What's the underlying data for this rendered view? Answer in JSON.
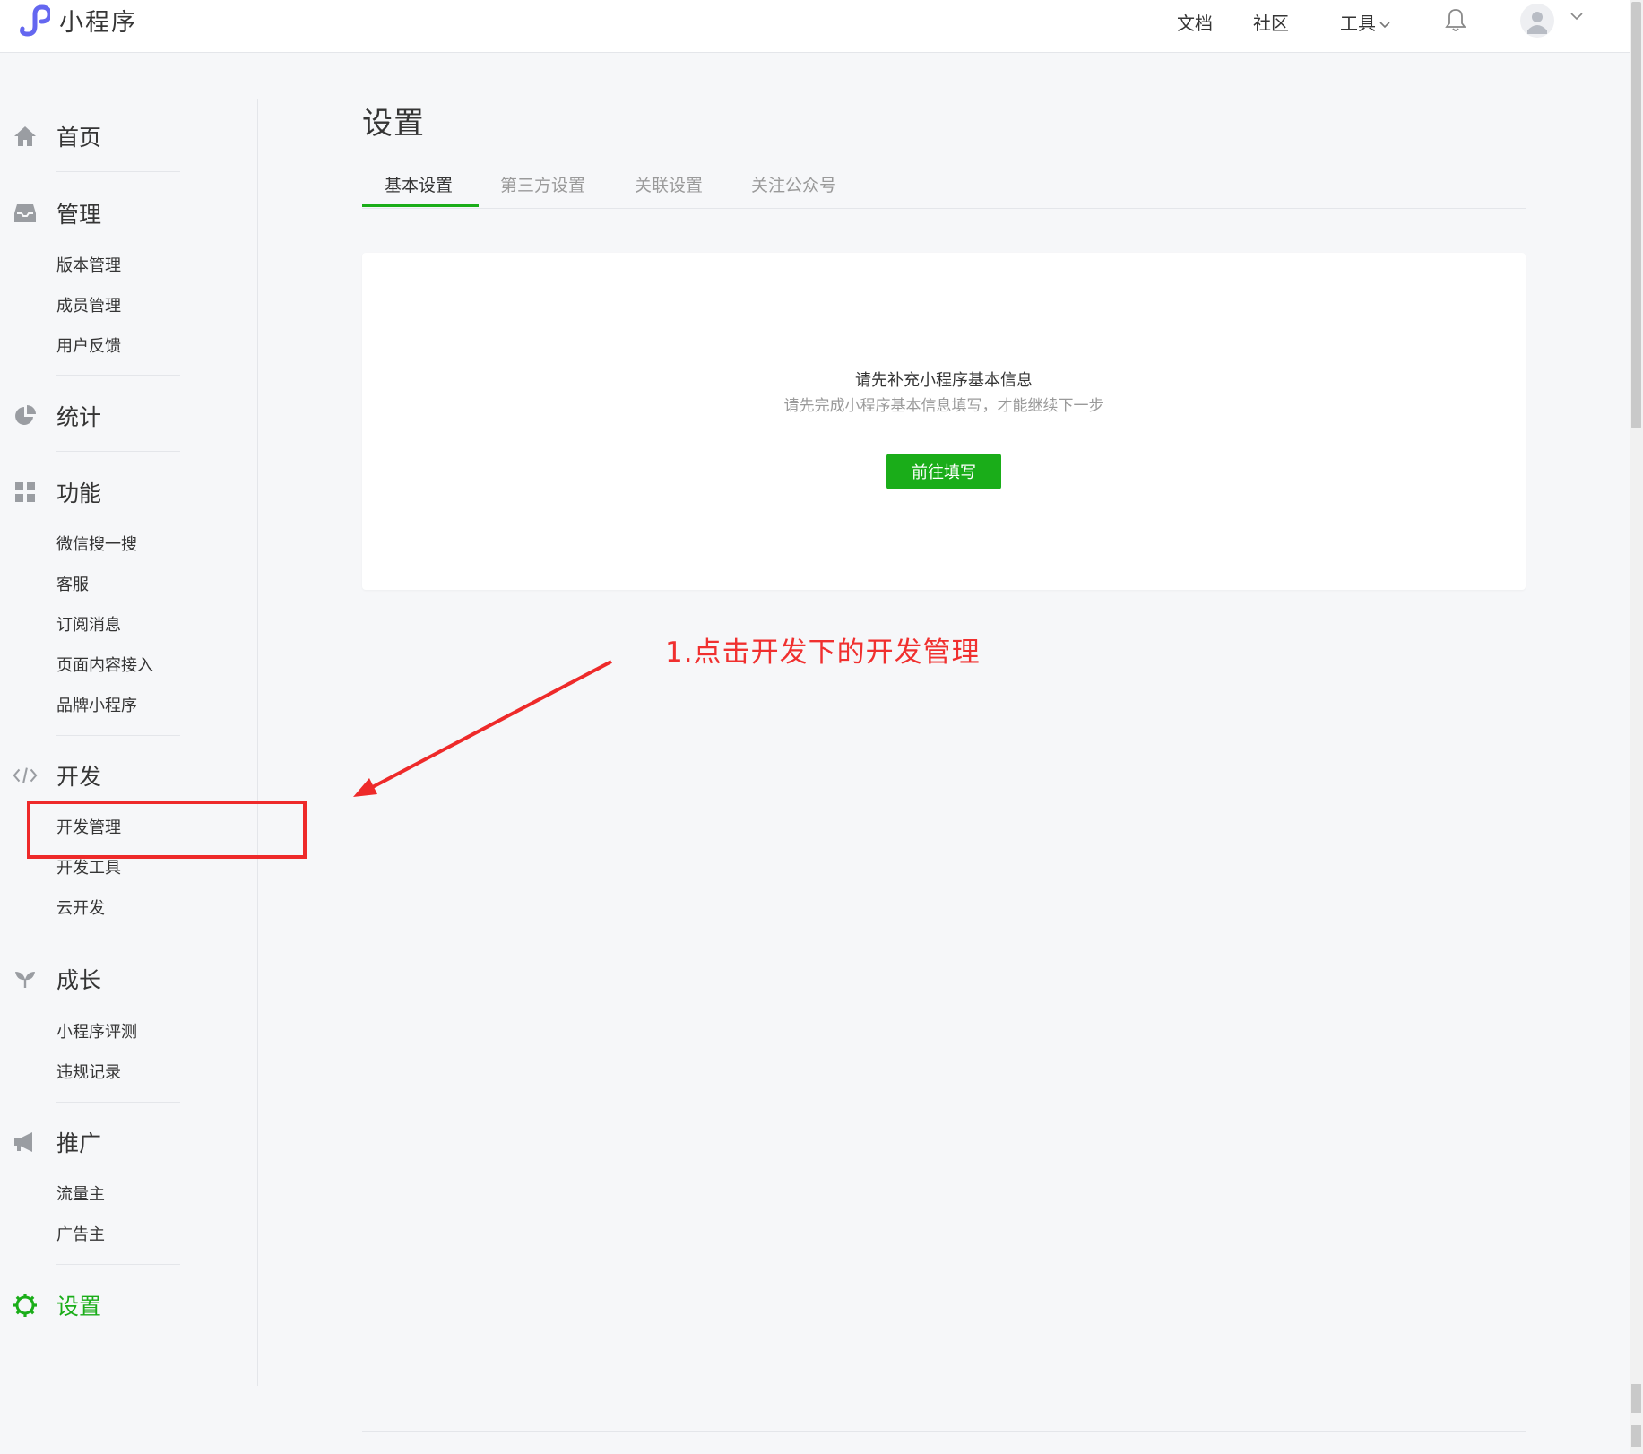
{
  "header": {
    "app_name": "小程序",
    "links": {
      "docs": "文档",
      "community": "社区",
      "tools": "工具"
    }
  },
  "sidebar": {
    "home": "首页",
    "manage": {
      "title": "管理",
      "items": [
        "版本管理",
        "成员管理",
        "用户反馈"
      ]
    },
    "stats": {
      "title": "统计"
    },
    "features": {
      "title": "功能",
      "items": [
        "微信搜一搜",
        "客服",
        "订阅消息",
        "页面内容接入",
        "品牌小程序"
      ]
    },
    "dev": {
      "title": "开发",
      "items": [
        "开发管理",
        "开发工具",
        "云开发"
      ]
    },
    "growth": {
      "title": "成长",
      "items": [
        "小程序评测",
        "违规记录"
      ]
    },
    "promo": {
      "title": "推广",
      "items": [
        "流量主",
        "广告主"
      ]
    },
    "settings": {
      "title": "设置"
    }
  },
  "main": {
    "title": "设置",
    "tabs": [
      "基本设置",
      "第三方设置",
      "关联设置",
      "关注公众号"
    ],
    "active_tab": "基本设置",
    "card": {
      "title": "请先补充小程序基本信息",
      "subtitle": "请先完成小程序基本信息填写，才能继续下一步",
      "button": "前往填写"
    }
  },
  "annotation": {
    "text": "1.点击开发下的开发管理"
  },
  "colors": {
    "accent_green": "#1aad19",
    "brand_purple": "#6467f0",
    "annotation_red": "#f0302f",
    "background": "#f6f7f9"
  },
  "icons": [
    "logo-icon",
    "home-icon",
    "inbox-icon",
    "pie-chart-icon",
    "grid-icon",
    "code-icon",
    "sprout-icon",
    "megaphone-icon",
    "gear-icon",
    "bell-icon",
    "user-icon",
    "chevron-down-icon"
  ]
}
